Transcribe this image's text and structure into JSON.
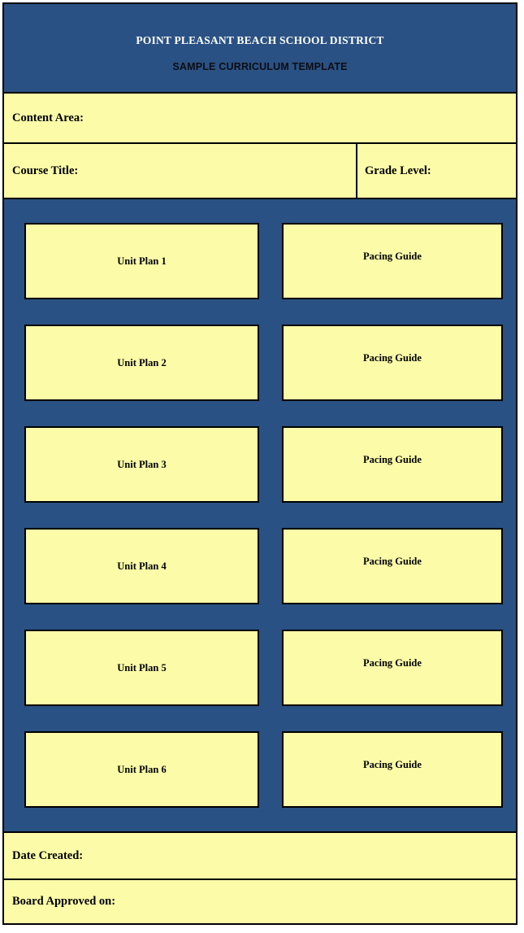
{
  "document": {
    "header": {
      "district_title": "POINT PLEASANT BEACH SCHOOL DISTRICT",
      "template_subtitle": "SAMPLE CURRICULUM TEMPLATE"
    },
    "form_fields": {
      "content_area_label": "Content Area:",
      "content_area_value": "",
      "course_title_label": "Course Title:",
      "course_title_value": "",
      "grade_level_label": "Grade Level:",
      "grade_level_value": "",
      "date_created_label": "Date Created:",
      "date_created_value": "",
      "board_approved_label": "Board Approved on:",
      "board_approved_value": ""
    },
    "unit_rows": [
      {
        "unit_label": "Unit Plan 1",
        "pacing_label": "Pacing Guide"
      },
      {
        "unit_label": "Unit Plan 2",
        "pacing_label": "Pacing Guide"
      },
      {
        "unit_label": "Unit Plan 3",
        "pacing_label": "Pacing Guide"
      },
      {
        "unit_label": "Unit Plan 4",
        "pacing_label": "Pacing Guide"
      },
      {
        "unit_label": "Unit Plan 5",
        "pacing_label": "Pacing Guide"
      },
      {
        "unit_label": "Unit Plan 6",
        "pacing_label": "Pacing Guide"
      }
    ],
    "colors": {
      "header_background": "#2a5183",
      "body_background": "#2a5183",
      "field_background": "#fcfca8",
      "border": "#000000",
      "district_title_text": "#ffffff",
      "body_text": "#000000"
    }
  }
}
